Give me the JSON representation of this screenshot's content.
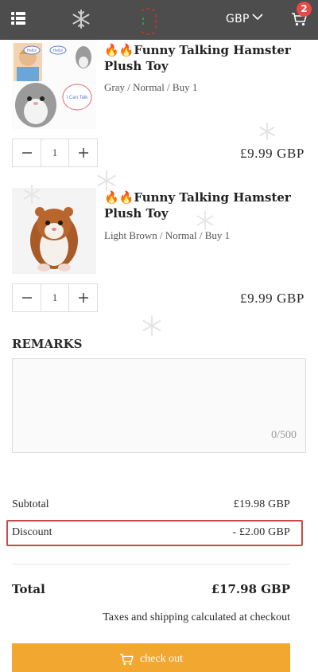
{
  "header": {
    "currency": "GBP",
    "cart_count": "2"
  },
  "items": [
    {
      "title": "🔥🔥Funny Talking Hamster Plush Toy",
      "variant": "Gray / Normal / Buy 1",
      "quantity": "1",
      "price": "£9.99 GBP",
      "image_bubble_1": "Hello!",
      "image_bubble_2": "Hello!",
      "image_bubble_3": "I Can Talk"
    },
    {
      "title": "🔥🔥Funny Talking Hamster Plush Toy",
      "variant": "Light Brown / Normal / Buy 1",
      "quantity": "1",
      "price": "£9.99 GBP"
    }
  ],
  "remarks": {
    "label": "REMARKS",
    "counter": "0/500"
  },
  "summary": {
    "subtotal_label": "Subtotal",
    "subtotal_value": "£19.98 GBP",
    "discount_label": "Discount",
    "discount_value": "- £2.00 GBP",
    "total_label": "Total",
    "total_value": "£17.98 GBP",
    "tax_note": "Taxes and shipping calculated at checkout"
  },
  "checkout": {
    "label": "check out"
  },
  "colors": {
    "header_bg": "#4d4d4d",
    "badge": "#e84949",
    "checkout_bg": "#f2a731",
    "highlight_border": "#c84a4a"
  }
}
